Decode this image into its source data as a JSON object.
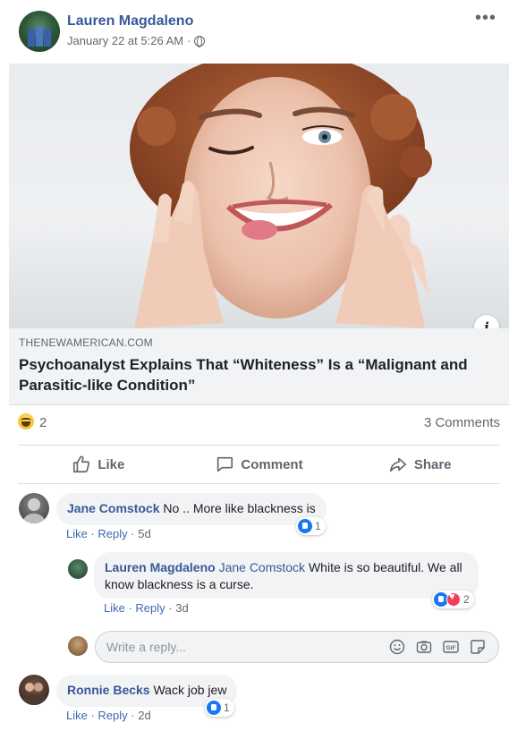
{
  "post": {
    "author": "Lauren Magdaleno",
    "date": "January 22 at 5:26 AM",
    "separator": "·"
  },
  "link": {
    "domain": "THENEWAMERICAN.COM",
    "title": "Psychoanalyst Explains That “Whiteness” Is a “Malignant and Parasitic-like Condition”"
  },
  "reactions": {
    "count": "2",
    "comments": "3 Comments"
  },
  "actions": {
    "like": "Like",
    "comment": "Comment",
    "share": "Share"
  },
  "comments": [
    {
      "author": "Jane Comstock",
      "text": "No .. More like blackness is",
      "like_label": "Like",
      "reply_label": "Reply",
      "time": "5d",
      "reaction_count": "1"
    },
    {
      "author": "Lauren Magdaleno",
      "tag": "Jane Comstock",
      "text": "White is so beautiful. We all know blackness is a curse.",
      "like_label": "Like",
      "reply_label": "Reply",
      "time": "3d",
      "reaction_count": "2"
    },
    {
      "author": "Ronnie Becks",
      "text": "Wack job jew",
      "like_label": "Like",
      "reply_label": "Reply",
      "time": "2d",
      "reaction_count": "1"
    }
  ],
  "reply": {
    "placeholder": "Write a reply..."
  },
  "colors": {
    "name_blue": "#385898",
    "link_blue": "#4267b2",
    "meta_gray": "#606770",
    "bubble_bg": "#f2f3f5",
    "like_blue": "#1877f2",
    "love_red": "#f33e58"
  }
}
